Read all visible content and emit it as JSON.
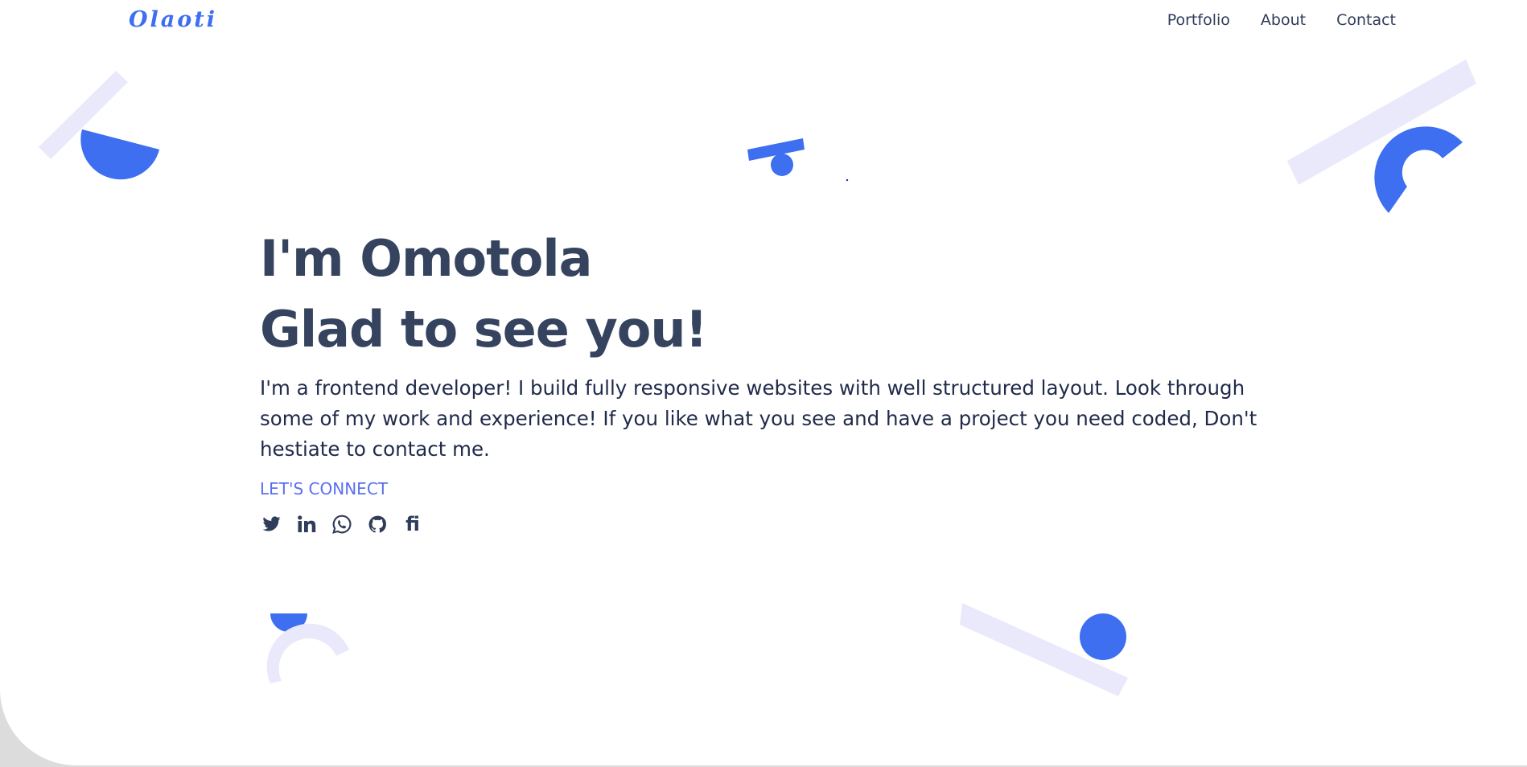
{
  "brand": {
    "logo_text": "Olaoti",
    "accent": "#3d6ff0",
    "text_dark": "#2f3c5a",
    "shape_light": "#e9e9fb"
  },
  "nav": {
    "links": [
      {
        "label": "Portfolio"
      },
      {
        "label": "About"
      },
      {
        "label": "Contact"
      }
    ]
  },
  "hero": {
    "title_line1": "I'm Omotola",
    "title_line2": "Glad to see you!",
    "intro": "I'm a frontend developer! I build fully responsive websites with well structured layout. Look through some of my work and experience! If you like what you see and have a project you need coded, Don't hestiate to contact me.",
    "connect_label": "LET'S CONNECT"
  },
  "socials": [
    {
      "icon": "twitter-icon"
    },
    {
      "icon": "linkedin-icon"
    },
    {
      "icon": "whatsapp-icon"
    },
    {
      "icon": "github-icon"
    },
    {
      "icon": "fi-icon",
      "label": "fi"
    }
  ]
}
